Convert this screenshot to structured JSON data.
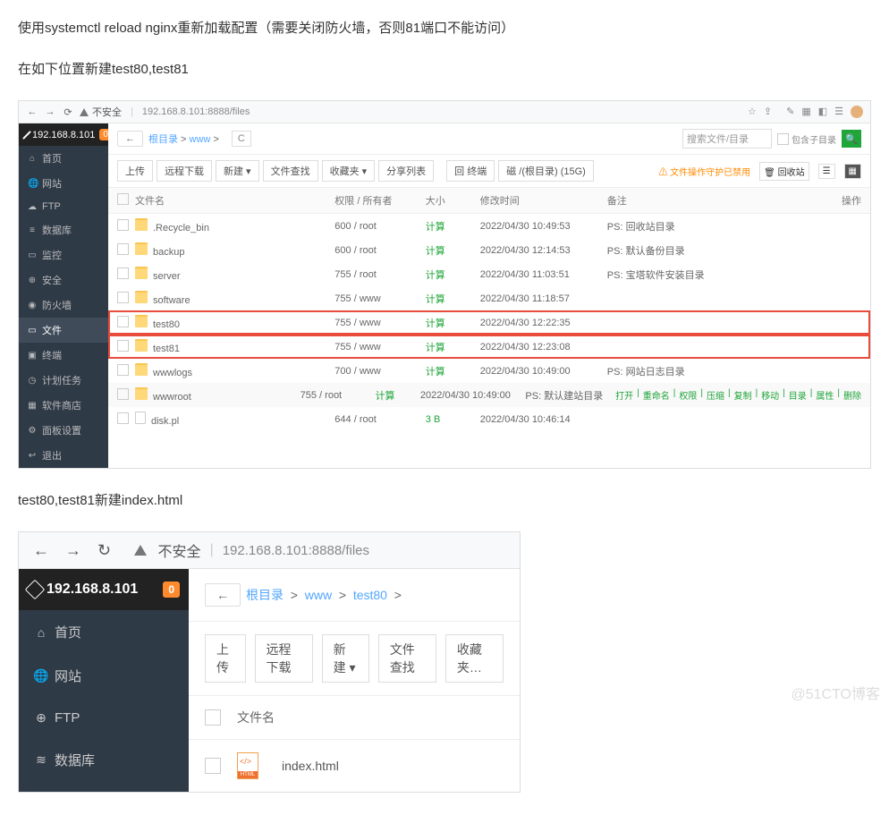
{
  "text": {
    "p1": "使用systemctl reload nginx重新加载配置（需要关闭防火墙，否则81端口不能访问）",
    "p2": "在如下位置新建test80,test81",
    "p3": "test80,test81新建index.html"
  },
  "shot1": {
    "url_unsafe": "不安全",
    "url": "192.168.8.101:8888/files",
    "ip": "192.168.8.101",
    "badge": "0",
    "menu": [
      "首页",
      "网站",
      "FTP",
      "数据库",
      "监控",
      "安全",
      "防火墙",
      "文件",
      "终端",
      "计划任务",
      "软件商店",
      "面板设置",
      "退出"
    ],
    "active_index": 7,
    "breadcrumb_back": "←",
    "breadcrumb": [
      "根目录",
      "www"
    ],
    "search_placeholder": "搜索文件/目录",
    "include_sub": "包含子目录",
    "refresh": "C",
    "toolbar": [
      "上传",
      "远程下载",
      "新建 ▾",
      "文件查找",
      "收藏夹 ▾",
      "分享列表",
      "回 终端",
      "磁 /(根目录) (15G)"
    ],
    "disk_msg": "文件操作守护已禁用",
    "recycle": "回收站",
    "headers": {
      "name": "文件名",
      "perm": "权限 / 所有者",
      "size": "大小",
      "mtime": "修改时间",
      "note": "备注",
      "act": "操作"
    },
    "rows": [
      {
        "icon": "folder",
        "name": ".Recycle_bin",
        "perm": "600 / root",
        "size": "计算",
        "mtime": "2022/04/30 10:49:53",
        "note": "PS: 回收站目录",
        "hl": false
      },
      {
        "icon": "folder",
        "name": "backup",
        "perm": "600 / root",
        "size": "计算",
        "mtime": "2022/04/30 12:14:53",
        "note": "PS: 默认备份目录",
        "hl": false
      },
      {
        "icon": "folder",
        "name": "server",
        "perm": "755 / root",
        "size": "计算",
        "mtime": "2022/04/30 11:03:51",
        "note": "PS: 宝塔软件安装目录",
        "hl": false
      },
      {
        "icon": "folder",
        "name": "software",
        "perm": "755 / www",
        "size": "计算",
        "mtime": "2022/04/30 11:18:57",
        "note": "",
        "hl": false
      },
      {
        "icon": "folder",
        "name": "test80",
        "perm": "755 / www",
        "size": "计算",
        "mtime": "2022/04/30 12:22:35",
        "note": "",
        "hl": true
      },
      {
        "icon": "folder",
        "name": "test81",
        "perm": "755 / www",
        "size": "计算",
        "mtime": "2022/04/30 12:23:08",
        "note": "",
        "hl": true
      },
      {
        "icon": "folder",
        "name": "wwwlogs",
        "perm": "700 / www",
        "size": "计算",
        "mtime": "2022/04/30 10:49:00",
        "note": "PS: 网站日志目录",
        "hl": false
      },
      {
        "icon": "folder",
        "name": "wwwroot",
        "perm": "755 / root",
        "size": "计算",
        "mtime": "2022/04/30 10:49:00",
        "note": "PS: 默认建站目录",
        "hl": false,
        "light": true,
        "actions": [
          "打开",
          "重命名",
          "权限",
          "压缩",
          "复制",
          "移动",
          "目录",
          "属性",
          "删除"
        ]
      },
      {
        "icon": "file",
        "name": "disk.pl",
        "perm": "644 / root",
        "size": "3 B",
        "mtime": "2022/04/30 10:46:14",
        "note": "",
        "hl": false
      }
    ]
  },
  "shot2": {
    "url_unsafe": "不安全",
    "url": "192.168.8.101:8888/files",
    "ip": "192.168.8.101",
    "badge": "0",
    "menu": [
      "首页",
      "网站",
      "FTP",
      "数据库"
    ],
    "breadcrumb_back": "←",
    "breadcrumb": [
      "根目录",
      "www",
      "test80"
    ],
    "toolbar": [
      "上传",
      "远程下载",
      "新建 ▾",
      "文件查找",
      "收藏夹…"
    ],
    "header_name": "文件名",
    "file": "index.html"
  },
  "watermark": "@51CTO博客"
}
